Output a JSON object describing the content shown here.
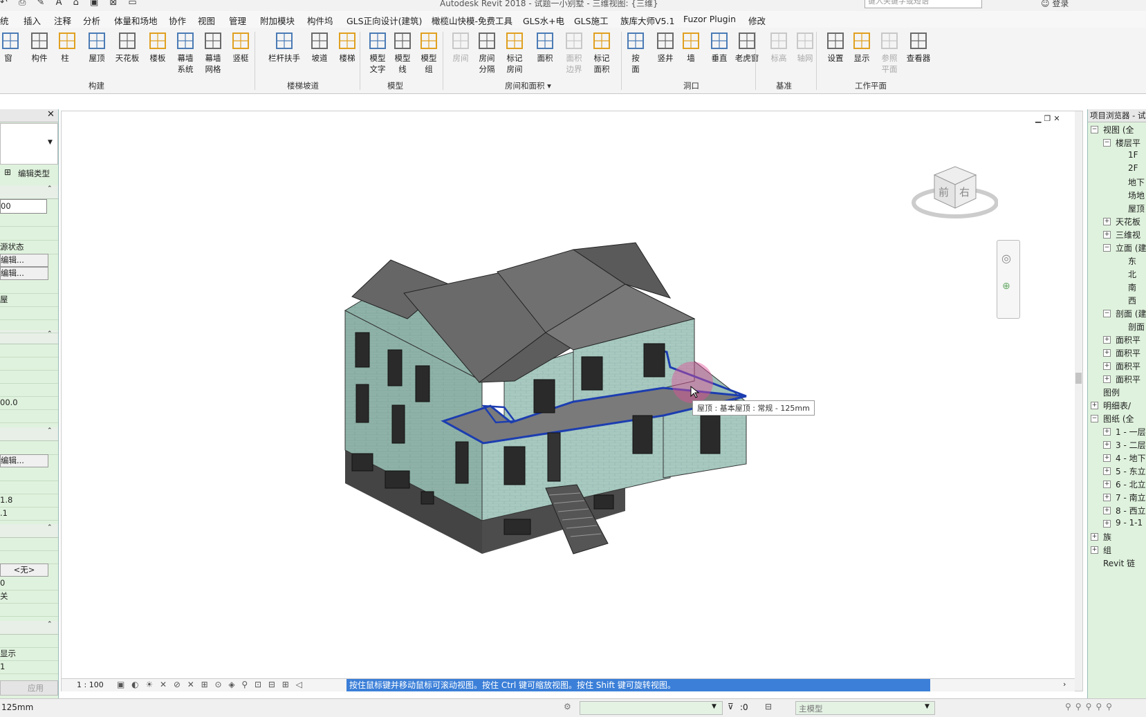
{
  "titlebar": {
    "title": "Autodesk Revit 2018 -   试题一小别墅 - 三维视图: {三维}",
    "search_placeholder": "键入关键字或短语",
    "login": "登录"
  },
  "menu": [
    "统",
    "插入",
    "注释",
    "分析",
    "体量和场地",
    "协作",
    "视图",
    "管理",
    "附加模块",
    "构件坞",
    "GLS正向设计(建筑)",
    "橄榄山快模-免费工具",
    "GLS水+电",
    "GLS施工",
    "族库大师V5.1",
    "Fuzor Plugin",
    "修改"
  ],
  "ribbon": {
    "buttons": [
      {
        "label": "窗",
        "icon": "window-icon"
      },
      {
        "label": "构件",
        "icon": "component-icon"
      },
      {
        "label": "柱",
        "icon": "column-icon"
      },
      {
        "label": "屋顶",
        "icon": "roof-icon"
      },
      {
        "label": "天花板",
        "icon": "ceiling-icon"
      },
      {
        "label": "楼板",
        "icon": "floor-icon"
      },
      {
        "label": "幕墙\n系统",
        "icon": "curtain-system-icon"
      },
      {
        "label": "幕墙\n网格",
        "icon": "curtain-grid-icon"
      },
      {
        "label": "竖梃",
        "icon": "mullion-icon"
      },
      {
        "label": "栏杆扶手",
        "icon": "railing-icon"
      },
      {
        "label": "坡道",
        "icon": "ramp-icon"
      },
      {
        "label": "楼梯",
        "icon": "stair-icon"
      },
      {
        "label": "模型\n文字",
        "icon": "model-text-icon"
      },
      {
        "label": "模型\n线",
        "icon": "model-line-icon"
      },
      {
        "label": "模型\n组",
        "icon": "model-group-icon"
      },
      {
        "label": "房间",
        "icon": "room-icon",
        "disabled": true
      },
      {
        "label": "房间\n分隔",
        "icon": "room-separator-icon"
      },
      {
        "label": "标记\n房间",
        "icon": "tag-room-icon"
      },
      {
        "label": "面积",
        "icon": "area-icon"
      },
      {
        "label": "面积\n边界",
        "icon": "area-boundary-icon",
        "disabled": true
      },
      {
        "label": "标记\n面积",
        "icon": "tag-area-icon"
      },
      {
        "label": "按\n面",
        "icon": "by-face-icon"
      },
      {
        "label": "竖井",
        "icon": "shaft-icon"
      },
      {
        "label": "墙",
        "icon": "wall-opening-icon"
      },
      {
        "label": "垂直",
        "icon": "vertical-opening-icon"
      },
      {
        "label": "老虎窗",
        "icon": "dormer-icon"
      },
      {
        "label": "标高",
        "icon": "level-icon",
        "disabled": true
      },
      {
        "label": "轴网",
        "icon": "grid-icon",
        "disabled": true
      },
      {
        "label": "设置",
        "icon": "set-workplane-icon"
      },
      {
        "label": "显示",
        "icon": "show-workplane-icon"
      },
      {
        "label": "参照\n平面",
        "icon": "ref-plane-icon",
        "disabled": true
      },
      {
        "label": "查看器",
        "icon": "viewer-icon"
      }
    ],
    "groups": [
      "构建",
      "楼梯坡道",
      "模型",
      "房间和面积 ▾",
      "洞口",
      "基准",
      "工作平面"
    ]
  },
  "properties": {
    "edit_type": "编辑类型",
    "rows": [
      "00",
      "",
      "",
      "源状态",
      "编辑...",
      "编辑...",
      "",
      "屋",
      "",
      "",
      "",
      "",
      "",
      "",
      "00.0",
      "",
      "",
      "编辑...",
      "",
      "",
      "1.8",
      ".1",
      "",
      "",
      "<无>",
      "0",
      "关",
      "",
      "",
      "显示",
      "1",
      ""
    ],
    "apply": "应用"
  },
  "viewport": {
    "tooltip": "屋顶 : 基本屋顶 : 常规 - 125mm",
    "viewcube_front": "前",
    "viewcube_right": "右",
    "scale": "1 : 100",
    "hint": "按住鼠标键并移动鼠标可滚动视图。按住 Ctrl 键可缩放视图。按住 Shift 键可旋转视图。"
  },
  "browser": {
    "title": "项目浏览器 - 试",
    "items": [
      {
        "label": "视图 (全",
        "level": 0,
        "toggle": "-"
      },
      {
        "label": "楼层平",
        "level": 1,
        "toggle": "-"
      },
      {
        "label": "1F",
        "level": 2
      },
      {
        "label": "2F",
        "level": 2
      },
      {
        "label": "地下",
        "level": 2
      },
      {
        "label": "场地",
        "level": 2
      },
      {
        "label": "屋顶",
        "level": 2
      },
      {
        "label": "天花板",
        "level": 1,
        "toggle": "+"
      },
      {
        "label": "三维视",
        "level": 1,
        "toggle": "+"
      },
      {
        "label": "立面 (建",
        "level": 1,
        "toggle": "-"
      },
      {
        "label": "东",
        "level": 2
      },
      {
        "label": "北",
        "level": 2
      },
      {
        "label": "南",
        "level": 2
      },
      {
        "label": "西",
        "level": 2
      },
      {
        "label": "剖面 (建",
        "level": 1,
        "toggle": "-"
      },
      {
        "label": "剖面",
        "level": 2
      },
      {
        "label": "面积平",
        "level": 1,
        "toggle": "+"
      },
      {
        "label": "面积平",
        "level": 1,
        "toggle": "+"
      },
      {
        "label": "面积平",
        "level": 1,
        "toggle": "+"
      },
      {
        "label": "面积平",
        "level": 1,
        "toggle": "+"
      },
      {
        "label": "图例",
        "level": 0
      },
      {
        "label": "明细表/",
        "level": 0,
        "toggle": "+"
      },
      {
        "label": "图纸 (全",
        "level": 0,
        "toggle": "-"
      },
      {
        "label": "1 - 一层",
        "level": 1,
        "toggle": "+"
      },
      {
        "label": "3 - 二层",
        "level": 1,
        "toggle": "+"
      },
      {
        "label": "4 - 地下",
        "level": 1,
        "toggle": "+"
      },
      {
        "label": "5 - 东立",
        "level": 1,
        "toggle": "+"
      },
      {
        "label": "6 - 北立",
        "level": 1,
        "toggle": "+"
      },
      {
        "label": "7 - 南立",
        "level": 1,
        "toggle": "+"
      },
      {
        "label": "8 - 西立",
        "level": 1,
        "toggle": "+"
      },
      {
        "label": "9 - 1-1",
        "level": 1,
        "toggle": "+"
      },
      {
        "label": "族",
        "level": 0,
        "toggle": "+"
      },
      {
        "label": "组",
        "level": 0,
        "toggle": "+"
      },
      {
        "label": "Revit 链",
        "level": 0
      }
    ]
  },
  "status": {
    "left": "125mm",
    "zero": ":0",
    "model": "主模型"
  }
}
